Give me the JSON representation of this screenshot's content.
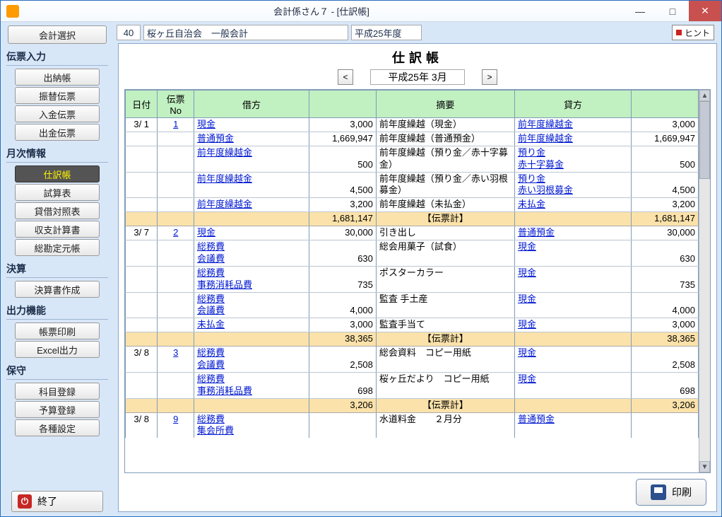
{
  "window": {
    "title": "会計係さん７ - [仕訳帳]"
  },
  "sidebar": {
    "select": "会計選択",
    "sections": {
      "input": {
        "label": "伝票入力",
        "items": [
          "出納帳",
          "振替伝票",
          "入金伝票",
          "出金伝票"
        ]
      },
      "monthly": {
        "label": "月次情報",
        "items": [
          "仕訳帳",
          "試算表",
          "貸借対照表",
          "収支計算書",
          "総勘定元帳"
        ]
      },
      "closing": {
        "label": "決算",
        "items": [
          "決算書作成"
        ]
      },
      "output": {
        "label": "出力機能",
        "items": [
          "帳票印刷",
          "Excel出力"
        ]
      },
      "maint": {
        "label": "保守",
        "items": [
          "科目登録",
          "予算登録",
          "各種設定"
        ]
      }
    },
    "exit": "終了"
  },
  "header": {
    "code": "40",
    "org": "桜ヶ丘自治会　一般会計",
    "fy": "平成25年度",
    "hint": "ヒント"
  },
  "content": {
    "title": "仕訳帳",
    "period": "平成25年 3月",
    "columns": [
      "日付",
      "伝票No",
      "借方",
      "",
      "摘要",
      "貸方",
      ""
    ],
    "subtotal_label": "【伝票計】",
    "rows": [
      {
        "date": "3/ 1",
        "slip": "1",
        "debit": "現金",
        "amt": "3,000",
        "summary": "前年度繰越（現金）",
        "credit": "前年度繰越金",
        "amt2": "3,000",
        "sep": true
      },
      {
        "date": "",
        "slip": "",
        "debit": "普通預金",
        "amt": "1,669,947",
        "summary": "前年度繰越（普通預金）",
        "credit": "前年度繰越金",
        "amt2": "1,669,947",
        "sep": true
      },
      {
        "date": "",
        "slip": "",
        "debit": "前年度繰越金",
        "amt": "500",
        "summary": "前年度繰越（預り金／赤十字募金）",
        "credit": "預り金\n赤十字募金",
        "amt2": "500",
        "sep": true
      },
      {
        "date": "",
        "slip": "",
        "debit": "前年度繰越金",
        "amt": "4,500",
        "summary": "前年度繰越（預り金／赤い羽根募金）",
        "credit": "預り金\n赤い羽根募金",
        "amt2": "4,500",
        "sep": true
      },
      {
        "date": "",
        "slip": "",
        "debit": "前年度繰越金",
        "amt": "3,200",
        "summary": "前年度繰越（未払金）",
        "credit": "未払金",
        "amt2": "3,200",
        "sep": true
      },
      {
        "subtotal": true,
        "amt": "1,681,147",
        "amt2": "1,681,147"
      },
      {
        "date": "3/ 7",
        "slip": "2",
        "debit": "現金",
        "amt": "30,000",
        "summary": "引き出し",
        "credit": "普通預金",
        "amt2": "30,000",
        "sep": true
      },
      {
        "date": "",
        "slip": "",
        "debit": "総務費\n会議費",
        "amt": "630",
        "summary": "総会用菓子（試食）",
        "credit": "現金",
        "amt2": "630",
        "sep": true
      },
      {
        "date": "",
        "slip": "",
        "debit": "総務費\n事務消耗品費",
        "amt": "735",
        "summary": "ポスターカラー",
        "credit": "現金",
        "amt2": "735",
        "sep": true
      },
      {
        "date": "",
        "slip": "",
        "debit": "総務費\n会議費",
        "amt": "4,000",
        "summary": "監査 手土産",
        "credit": "現金",
        "amt2": "4,000",
        "sep": true
      },
      {
        "date": "",
        "slip": "",
        "debit": "未払金",
        "amt": "3,000",
        "summary": "監査手当て",
        "credit": "現金",
        "amt2": "3,000",
        "sep": true
      },
      {
        "subtotal": true,
        "amt": "38,365",
        "amt2": "38,365"
      },
      {
        "date": "3/ 8",
        "slip": "3",
        "debit": "総務費\n会議費",
        "amt": "2,508",
        "summary": "総会資料　コピー用紙",
        "credit": "現金",
        "amt2": "2,508",
        "sep": true
      },
      {
        "date": "",
        "slip": "",
        "debit": "総務費\n事務消耗品費",
        "amt": "698",
        "summary": "桜ヶ丘だより　コピー用紙",
        "credit": "現金",
        "amt2": "698",
        "sep": true
      },
      {
        "subtotal": true,
        "amt": "3,206",
        "amt2": "3,206"
      },
      {
        "date": "3/ 8",
        "slip": "9",
        "debit": "総務費\n集会所費",
        "amt": "",
        "summary": "水道料金　　２月分",
        "credit": "普通預金",
        "amt2": "",
        "sep": false
      }
    ]
  },
  "footer": {
    "print": "印刷"
  }
}
